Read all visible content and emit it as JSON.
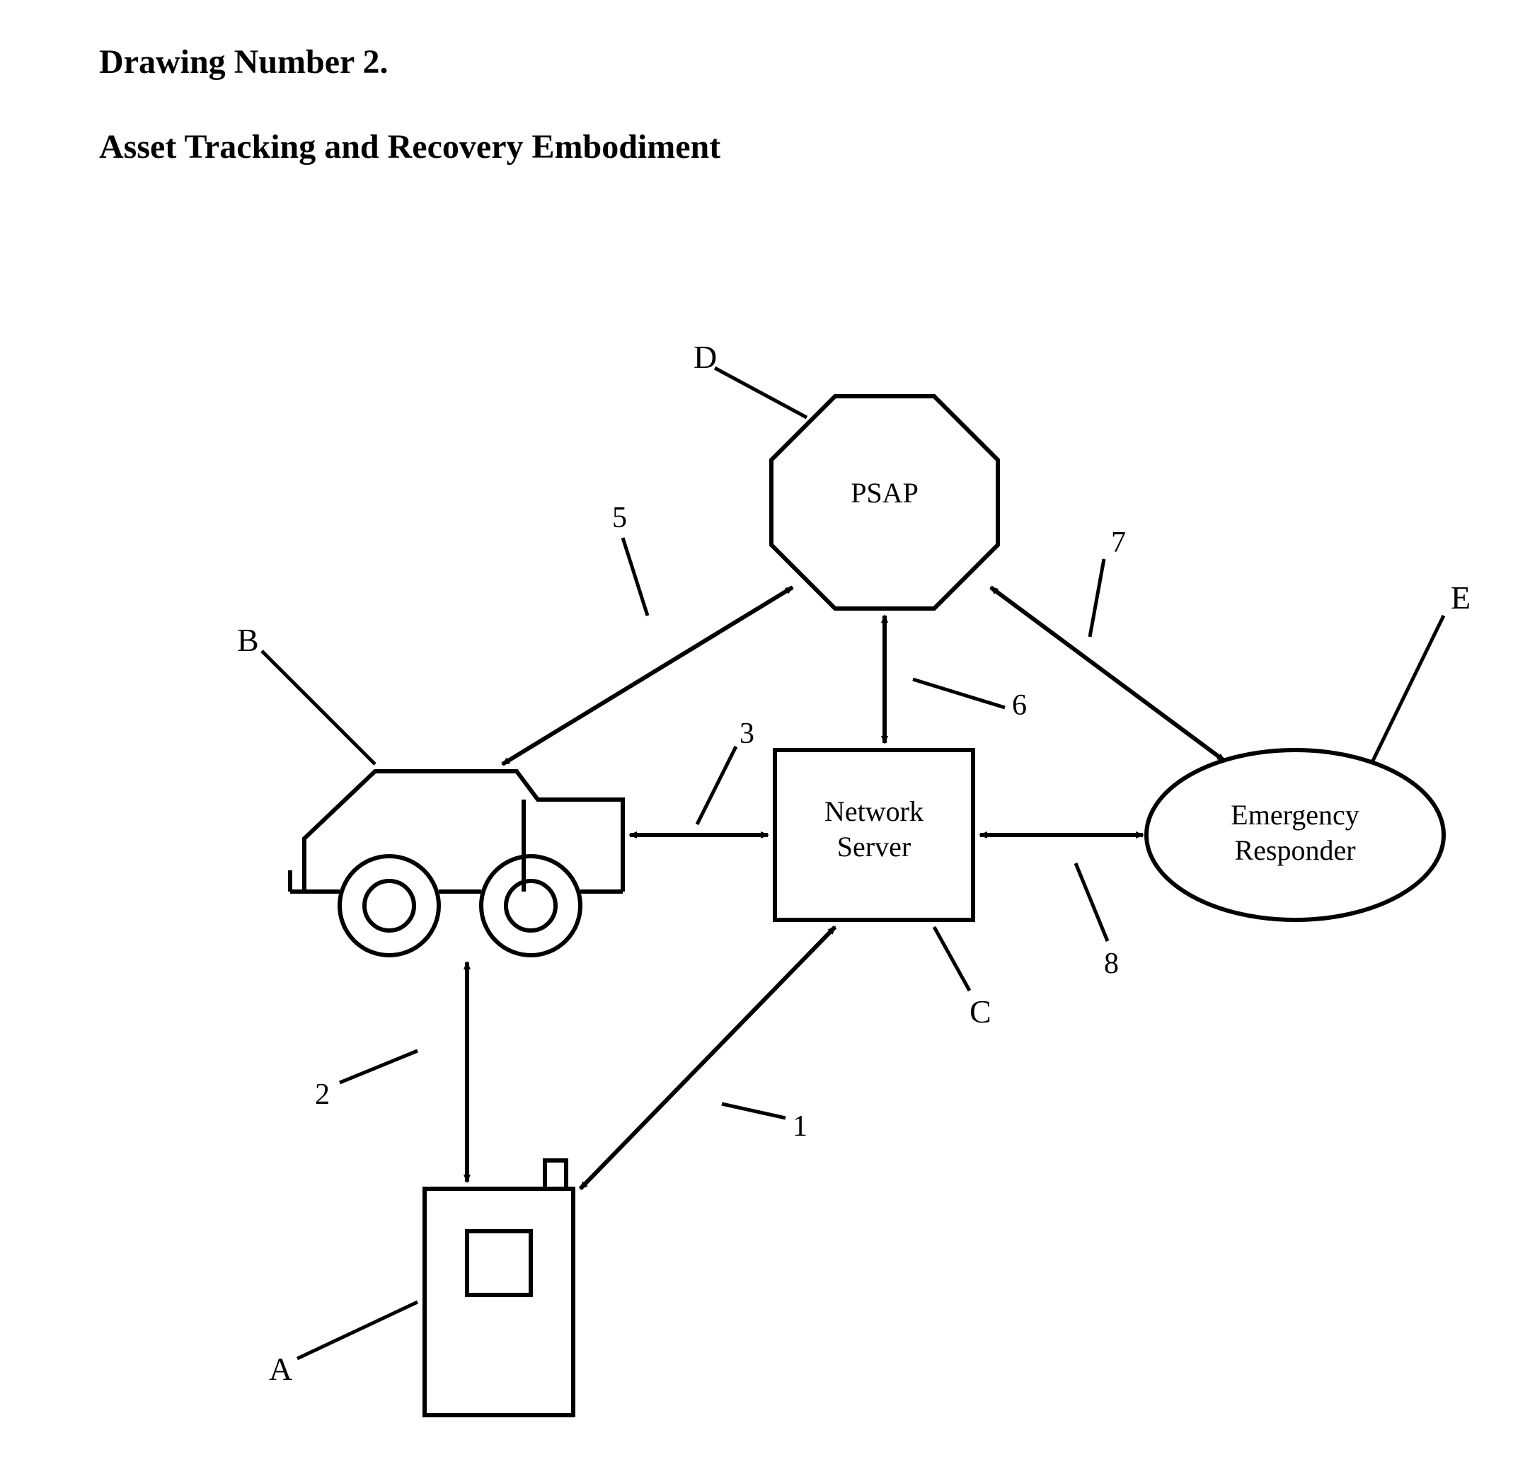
{
  "title": "Drawing Number 2.",
  "subtitle": "Asset Tracking and Recovery Embodiment",
  "nodes": {
    "psap": "PSAP",
    "network_server_line1": "Network",
    "network_server_line2": "Server",
    "emergency_line1": "Emergency",
    "emergency_line2": "Responder"
  },
  "refs": {
    "A": "A",
    "B": "B",
    "C": "C",
    "D": "D",
    "E": "E",
    "n1": "1",
    "n2": "2",
    "n3": "3",
    "n5": "5",
    "n6": "6",
    "n7": "7",
    "n8": "8"
  }
}
